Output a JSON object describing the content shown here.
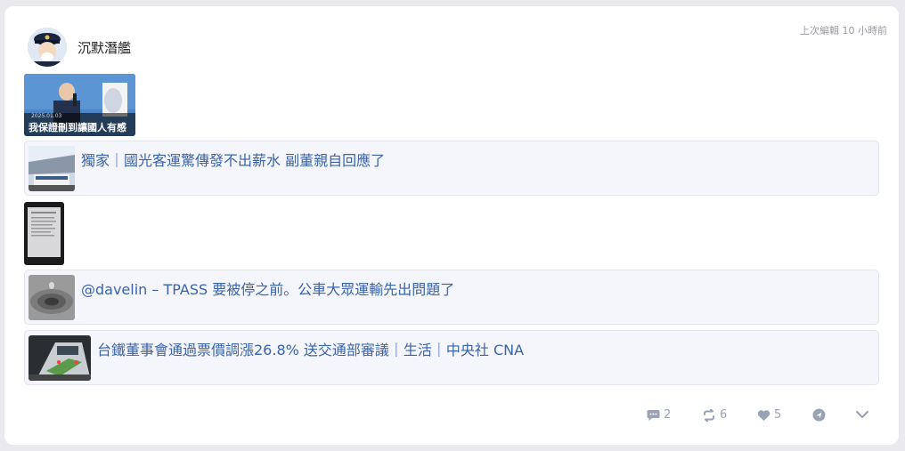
{
  "post": {
    "username": "沉默潛艦",
    "edited_label": "上次編輯 10 小時前",
    "image_caption": "我保證刪到讓國人有感",
    "image_date": "2025.01.03"
  },
  "link_cards": [
    {
      "title": "獨家｜國光客運驚傳發不出薪水 副董親自回應了"
    },
    {
      "title": "@davelin – TPASS 要被停之前。公車大眾運輸先出問題了"
    },
    {
      "title": "台鐵董事會通過票價調漲26.8% 送交通部審議｜生活｜中央社 CNA"
    }
  ],
  "actions": {
    "comments": "2",
    "reposts": "6",
    "likes": "5"
  },
  "colors": {
    "link": "#3a63a8",
    "card_bg": "#f5f6fb",
    "icon": "#9aa3b5"
  }
}
